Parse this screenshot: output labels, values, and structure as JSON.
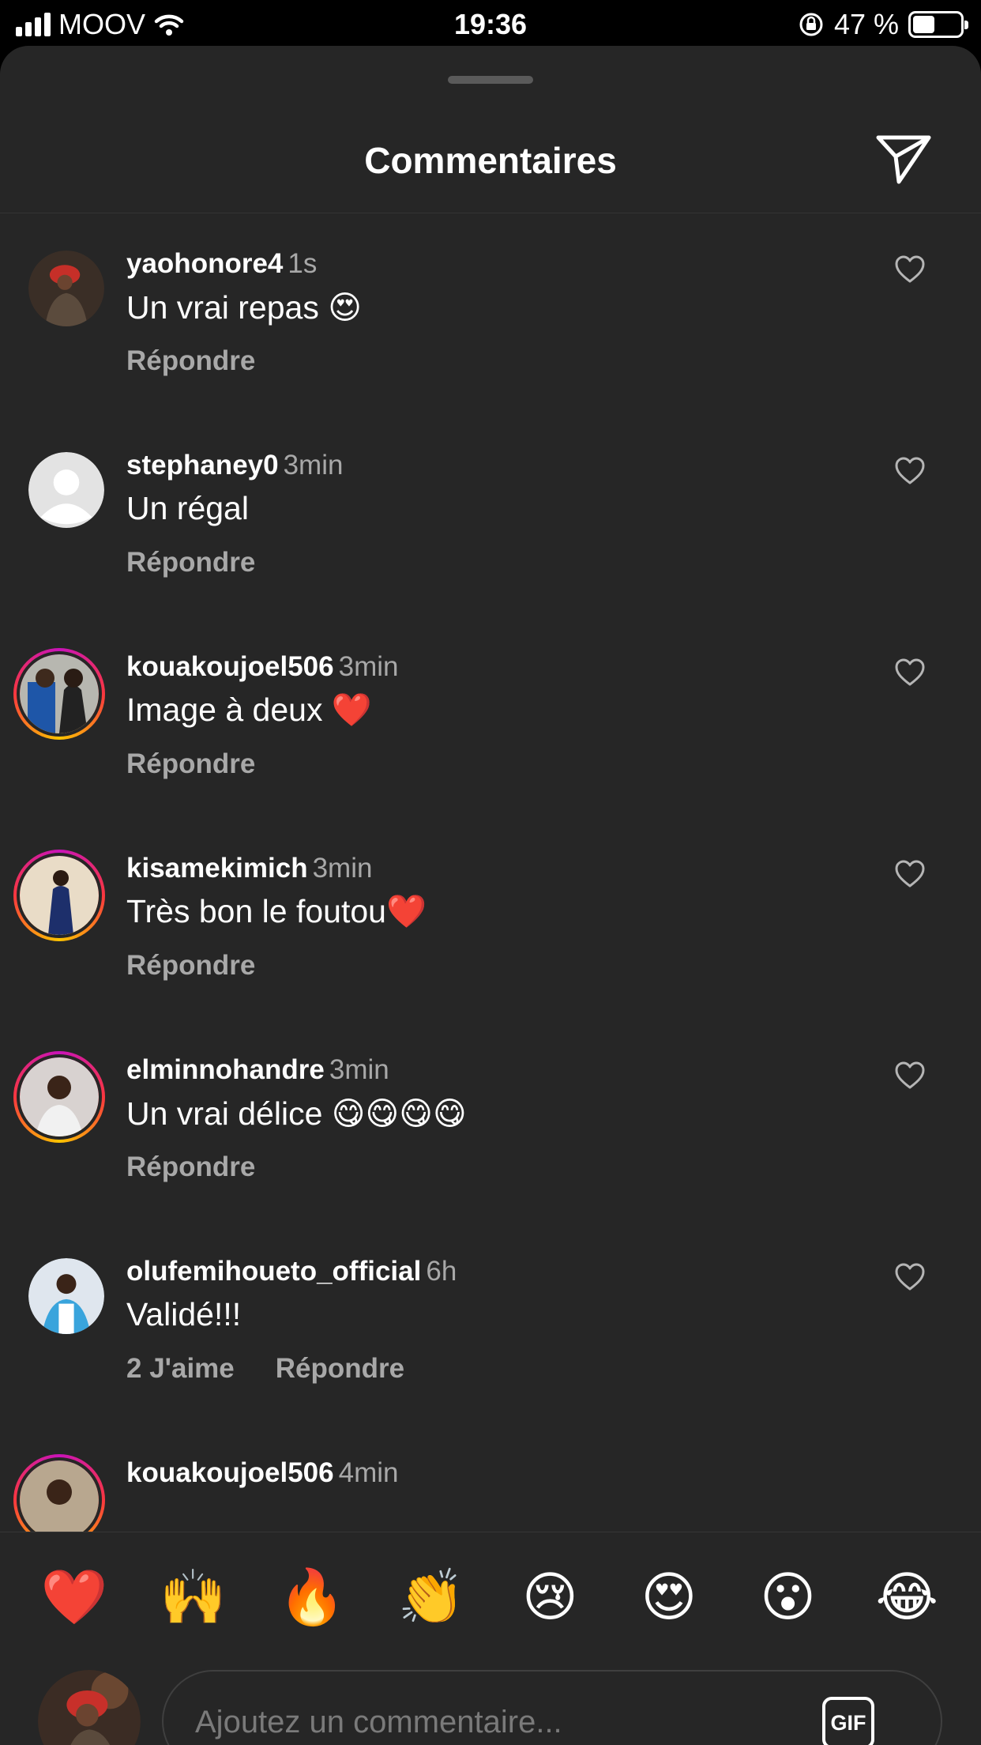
{
  "status_bar": {
    "carrier": "MOOV",
    "time": "19:36",
    "battery": "47 %",
    "battery_level": 0.47,
    "icons": [
      "signal-icon",
      "wifi-icon",
      "orientation-lock-icon",
      "battery-icon"
    ]
  },
  "header": {
    "title": "Commentaires",
    "send_icon": "paper-plane-icon"
  },
  "comments": [
    {
      "username": "yaohonore4",
      "time": "1s",
      "text": "Un vrai repas 😍",
      "likes": "",
      "reply": "Répondre",
      "story_ring": false
    },
    {
      "username": "stephaney0",
      "time": "3min",
      "text": "Un régal",
      "likes": "",
      "reply": "Répondre",
      "story_ring": false
    },
    {
      "username": "kouakoujoel506",
      "time": "3min",
      "text": "Image à deux ❤️",
      "likes": "",
      "reply": "Répondre",
      "story_ring": true
    },
    {
      "username": "kisamekimich",
      "time": "3min",
      "text": "Très bon le foutou❤️",
      "likes": "",
      "reply": "Répondre",
      "story_ring": true
    },
    {
      "username": "elminnohandre",
      "time": "3min",
      "text": "Un vrai délice 😋😋😋😋",
      "likes": "",
      "reply": "Répondre",
      "story_ring": true
    },
    {
      "username": "olufemihoueto_official",
      "time": "6h",
      "text": "Validé!!!",
      "likes": "2 J'aime",
      "reply": "Répondre",
      "story_ring": false
    },
    {
      "username": "kouakoujoel506",
      "time": "4min",
      "text": "",
      "likes": "",
      "reply": "",
      "story_ring": true
    }
  ],
  "reactions": [
    "❤️",
    "🙌",
    "🔥",
    "👏",
    "😢",
    "😍",
    "😮",
    "😂"
  ],
  "composer": {
    "placeholder": "Ajoutez un commentaire...",
    "gif_label": "GIF"
  },
  "colors": {
    "sheet_bg": "#262626",
    "secondary_text": "#a8a8a8",
    "placeholder": "#7a7a7a"
  }
}
